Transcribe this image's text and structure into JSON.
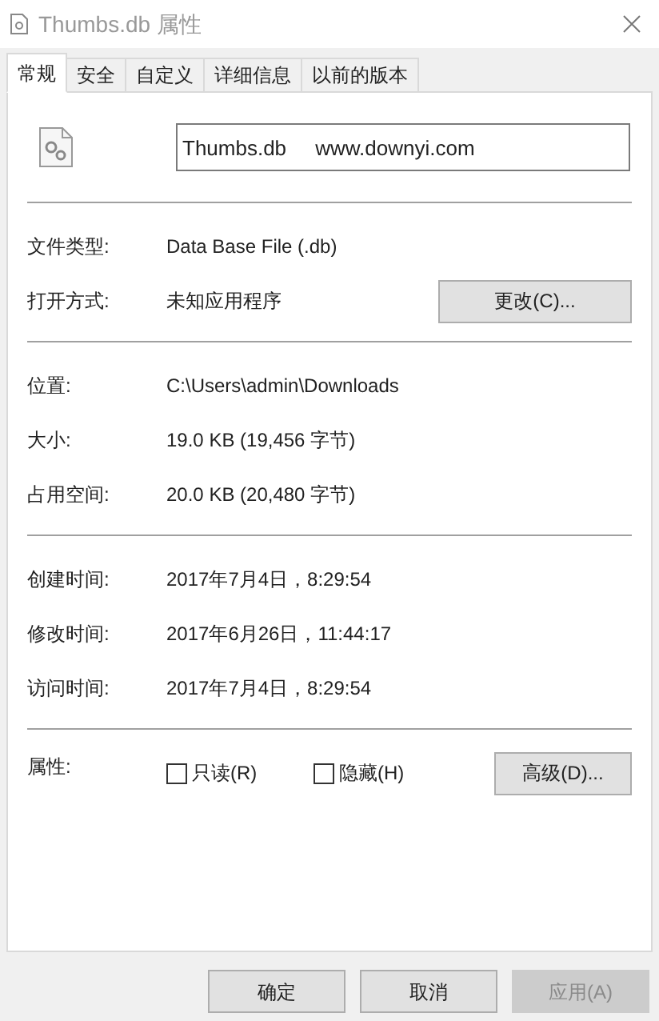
{
  "window": {
    "title": "Thumbs.db 属性"
  },
  "tabs": [
    {
      "label": "常规",
      "selected": true
    },
    {
      "label": "安全",
      "selected": false
    },
    {
      "label": "自定义",
      "selected": false
    },
    {
      "label": "详细信息",
      "selected": false
    },
    {
      "label": "以前的版本",
      "selected": false
    }
  ],
  "file_name": {
    "value": "Thumbs.db     www.downyi.com"
  },
  "sections": [
    {
      "rows": [
        {
          "label": "文件类型:",
          "value": "Data Base File (.db)"
        },
        {
          "label": "打开方式:",
          "value": "未知应用程序",
          "button": "更改(C)..."
        }
      ]
    },
    {
      "rows": [
        {
          "label": "位置:",
          "value": "C:\\Users\\admin\\Downloads"
        },
        {
          "label": "大小:",
          "value": "19.0 KB (19,456 字节)"
        },
        {
          "label": "占用空间:",
          "value": "20.0 KB (20,480 字节)"
        }
      ]
    },
    {
      "rows": [
        {
          "label": "创建时间:",
          "value": "2017年7月4日，8:29:54"
        },
        {
          "label": "修改时间:",
          "value": "2017年6月26日，11:44:17"
        },
        {
          "label": "访问时间:",
          "value": "2017年7月4日，8:29:54"
        }
      ]
    }
  ],
  "attributes": {
    "label": "属性:",
    "checkboxes": [
      {
        "label": "只读(R)",
        "checked": false
      },
      {
        "label": "隐藏(H)",
        "checked": false
      }
    ],
    "button": "高级(D)..."
  },
  "footer_buttons": [
    {
      "label": "确定",
      "disabled": false
    },
    {
      "label": "取消",
      "disabled": false
    },
    {
      "label": "应用(A)",
      "disabled": true
    }
  ]
}
